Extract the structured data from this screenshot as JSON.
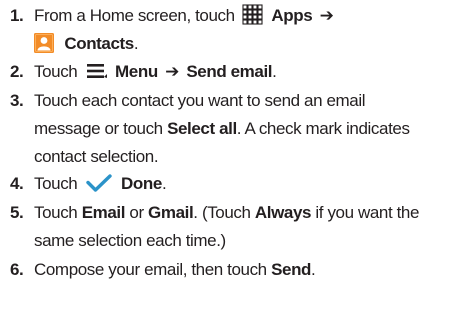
{
  "steps": [
    {
      "num": "1.",
      "parts": {
        "t1": "From a Home screen, touch",
        "apps": "Apps",
        "arrow": "➔",
        "contacts": "Contacts",
        "end": "."
      }
    },
    {
      "num": "2.",
      "parts": {
        "t1": "Touch",
        "menu": "Menu",
        "arrow": "➔",
        "send_email": "Send email",
        "end": "."
      }
    },
    {
      "num": "3.",
      "parts": {
        "t1": "Touch each contact you want to send an email",
        "t2": "message or touch",
        "select_all": "Select all",
        "t3": ". A check mark indicates",
        "t4": "contact selection."
      }
    },
    {
      "num": "4.",
      "parts": {
        "t1": "Touch",
        "done": "Done",
        "end": "."
      }
    },
    {
      "num": "5.",
      "parts": {
        "t1": "Touch",
        "email": "Email",
        "or": "or",
        "gmail": "Gmail",
        "t2": ". (Touch",
        "always": "Always",
        "t3": "if you want the",
        "t4": "same selection each time.)"
      }
    },
    {
      "num": "6.",
      "parts": {
        "t1": "Compose your email, then touch",
        "send": "Send",
        "end": "."
      }
    }
  ],
  "icons": {
    "apps": "apps-grid-icon",
    "contacts": "contacts-icon",
    "menu": "menu-icon",
    "done": "checkmark-icon"
  },
  "colors": {
    "text": "#231f20",
    "contacts_icon": "#f28c28",
    "done_check": "#2b93c9"
  }
}
